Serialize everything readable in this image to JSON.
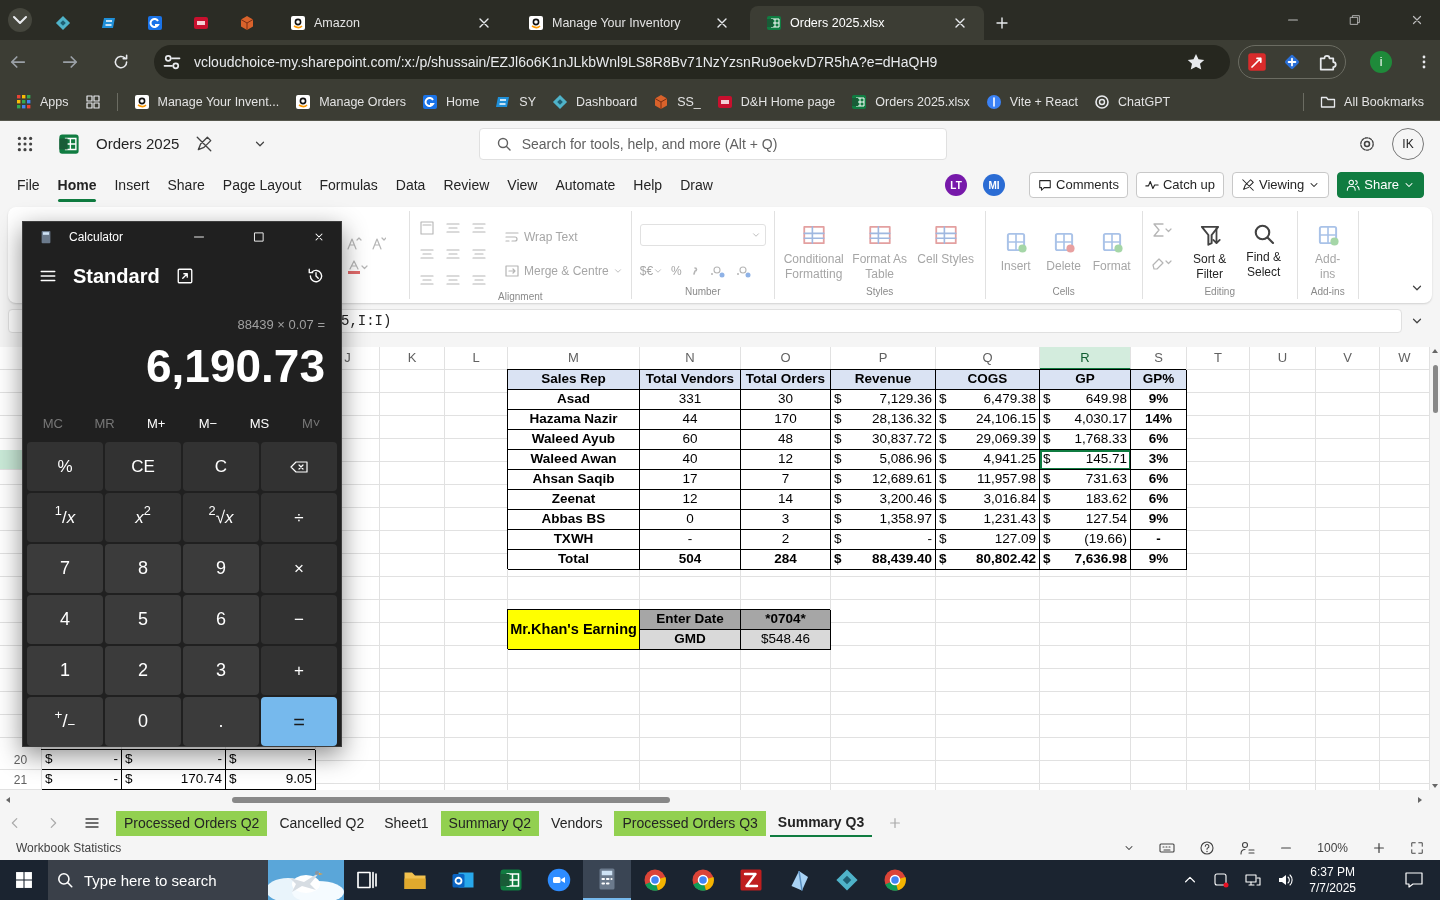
{
  "browser": {
    "tabs": [
      {
        "kind": "pinned",
        "selected": false
      },
      {
        "kind": "pinned",
        "selected": false
      },
      {
        "kind": "pinned",
        "selected": false
      },
      {
        "kind": "pinned",
        "selected": false
      },
      {
        "kind": "pinned",
        "selected": false
      },
      {
        "kind": "page",
        "title": "Amazon",
        "selected": false
      },
      {
        "kind": "page",
        "title": "Manage Your Inventory",
        "selected": false
      },
      {
        "kind": "page",
        "title": "Orders 2025.xlsx",
        "selected": true
      }
    ],
    "url": "vcloudchoice-my.sharepoint.com/:x:/p/shussain/EZJl6o6K1nJLkbWnl9LS8R8Bv71NzYzsnRu9oekvD7R5hA?e=dHaQH9",
    "profile_initial": "i",
    "bookmarks": [
      {
        "label": "Apps"
      },
      {
        "label": "Manage Your Invent..."
      },
      {
        "label": "Manage Orders"
      },
      {
        "label": "Home"
      },
      {
        "label": "SY"
      },
      {
        "label": "Dashboard"
      },
      {
        "label": "SS_"
      },
      {
        "label": "D&H Home page"
      },
      {
        "label": "Orders 2025.xlsx"
      },
      {
        "label": "Vite + React"
      },
      {
        "label": "ChatGPT"
      }
    ],
    "all_bookmarks": "All Bookmarks"
  },
  "excel": {
    "title": "Orders 2025",
    "search_placeholder": "Search for tools, help, and more (Alt + Q)",
    "user_initials": "IK",
    "menu": [
      {
        "label": "File",
        "selected": false
      },
      {
        "label": "Home",
        "selected": true
      },
      {
        "label": "Insert",
        "selected": false
      },
      {
        "label": "Share",
        "selected": false
      },
      {
        "label": "Page Layout",
        "selected": false
      },
      {
        "label": "Formulas",
        "selected": false
      },
      {
        "label": "Data",
        "selected": false
      },
      {
        "label": "Review",
        "selected": false
      },
      {
        "label": "View",
        "selected": false
      },
      {
        "label": "Automate",
        "selected": false
      },
      {
        "label": "Help",
        "selected": false
      },
      {
        "label": "Draw",
        "selected": false
      }
    ],
    "collaborators": [
      {
        "initials": "LT",
        "color": "#7719aa"
      },
      {
        "initials": "MI",
        "color": "#2b6cd4"
      }
    ],
    "actions": [
      {
        "label": "Comments",
        "kind": "comments"
      },
      {
        "label": "Catch up",
        "kind": "catchup"
      },
      {
        "label": "Viewing",
        "kind": "viewing"
      },
      {
        "label": "Share",
        "kind": "share"
      }
    ],
    "ribbon_groups": [
      {
        "label": "Alignment",
        "kind": "alignment",
        "items": [
          "Wrap Text",
          "Merge & Centre"
        ]
      },
      {
        "label": "Number",
        "kind": "number",
        "items": [
          "$€",
          "%"
        ]
      },
      {
        "label": "Styles",
        "kind": "large",
        "items": [
          "Conditional Formatting",
          "Format As Table",
          "Cell Styles"
        ]
      },
      {
        "label": "Cells",
        "kind": "large",
        "items": [
          "Insert",
          "Delete",
          "Format"
        ]
      },
      {
        "label": "Editing",
        "kind": "editing",
        "items": [
          "Sort & Filter",
          "Find & Select"
        ]
      },
      {
        "label": "Add-ins",
        "kind": "large",
        "items": [
          "Add-ins"
        ]
      }
    ],
    "formula": "5,I:I)",
    "columns": [
      {
        "label": "J",
        "selected": false
      },
      {
        "label": "K",
        "selected": false
      },
      {
        "label": "L",
        "selected": false
      },
      {
        "label": "M",
        "selected": false
      },
      {
        "label": "N",
        "selected": false
      },
      {
        "label": "O",
        "selected": false
      },
      {
        "label": "P",
        "selected": false
      },
      {
        "label": "Q",
        "selected": false
      },
      {
        "label": "R",
        "selected": true
      },
      {
        "label": "S",
        "selected": false
      },
      {
        "label": "T",
        "selected": false
      },
      {
        "label": "U",
        "selected": false
      },
      {
        "label": "V",
        "selected": false
      },
      {
        "label": "W",
        "selected": false
      }
    ],
    "summary": {
      "headers": [
        "Sales Rep",
        "Total Vendors",
        "Total Orders",
        "Revenue",
        "COGS",
        "GP",
        "GP%"
      ],
      "rows": [
        {
          "rep": "Asad",
          "vendors": "331",
          "orders": "30",
          "revenue": {
            "cur": "$",
            "amt": "7,129.36"
          },
          "cogs": {
            "cur": "$",
            "amt": "6,479.38"
          },
          "gp": {
            "cur": "$",
            "amt": "649.98"
          },
          "gp_pct": "9%",
          "active": false
        },
        {
          "rep": "Hazama Nazir",
          "vendors": "44",
          "orders": "170",
          "revenue": {
            "cur": "$",
            "amt": "28,136.32"
          },
          "cogs": {
            "cur": "$",
            "amt": "24,106.15"
          },
          "gp": {
            "cur": "$",
            "amt": "4,030.17"
          },
          "gp_pct": "14%",
          "active": false
        },
        {
          "rep": "Waleed Ayub",
          "vendors": "60",
          "orders": "48",
          "revenue": {
            "cur": "$",
            "amt": "30,837.72"
          },
          "cogs": {
            "cur": "$",
            "amt": "29,069.39"
          },
          "gp": {
            "cur": "$",
            "amt": "1,768.33"
          },
          "gp_pct": "6%",
          "active": false
        },
        {
          "rep": "Waleed Awan",
          "vendors": "40",
          "orders": "12",
          "revenue": {
            "cur": "$",
            "amt": "5,086.96"
          },
          "cogs": {
            "cur": "$",
            "amt": "4,941.25"
          },
          "gp": {
            "cur": "$",
            "amt": "145.71"
          },
          "gp_pct": "3%",
          "active": true
        },
        {
          "rep": "Ahsan Saqib",
          "vendors": "17",
          "orders": "7",
          "revenue": {
            "cur": "$",
            "amt": "12,689.61"
          },
          "cogs": {
            "cur": "$",
            "amt": "11,957.98"
          },
          "gp": {
            "cur": "$",
            "amt": "731.63"
          },
          "gp_pct": "6%",
          "active": false
        },
        {
          "rep": "Zeenat",
          "vendors": "12",
          "orders": "14",
          "revenue": {
            "cur": "$",
            "amt": "3,200.46"
          },
          "cogs": {
            "cur": "$",
            "amt": "3,016.84"
          },
          "gp": {
            "cur": "$",
            "amt": "183.62"
          },
          "gp_pct": "6%",
          "active": false
        },
        {
          "rep": "Abbas BS",
          "vendors": "0",
          "orders": "3",
          "revenue": {
            "cur": "$",
            "amt": "1,358.97"
          },
          "cogs": {
            "cur": "$",
            "amt": "1,231.43"
          },
          "gp": {
            "cur": "$",
            "amt": "127.54"
          },
          "gp_pct": "9%",
          "active": false
        },
        {
          "rep": "TXWH",
          "vendors": "-",
          "orders": "2",
          "revenue": {
            "cur": "$",
            "amt": "-"
          },
          "cogs": {
            "cur": "$",
            "amt": "127.09"
          },
          "gp": {
            "cur": "$",
            "amt": "(19.66)"
          },
          "gp_pct": "-",
          "active": false
        }
      ],
      "total": {
        "rep": "Total",
        "vendors": "504",
        "orders": "284",
        "revenue": {
          "cur": "$",
          "amt": "88,439.40"
        },
        "cogs": {
          "cur": "$",
          "amt": "80,802.42"
        },
        "gp": {
          "cur": "$",
          "amt": "7,636.98"
        },
        "gp_pct": "9%"
      }
    },
    "earning": {
      "label": "Mr.Khan's Earning",
      "rows": [
        {
          "label": "Enter Date",
          "value": "*0704*"
        },
        {
          "label": "GMD",
          "value": "$548.46"
        }
      ]
    },
    "lower_rows": [
      {
        "row": "20",
        "cells": [
          {
            "cur": "$",
            "amt": "-"
          },
          {
            "cur": "$",
            "amt": "-"
          },
          {
            "cur": "$",
            "amt": "-"
          }
        ]
      },
      {
        "row": "21",
        "cells": [
          {
            "cur": "$",
            "amt": "-"
          },
          {
            "cur": "$",
            "amt": "170.74"
          },
          {
            "cur": "$",
            "amt": "9.05"
          }
        ]
      }
    ],
    "sheet_tabs": [
      {
        "label": "Processed Orders Q2",
        "selected": false,
        "color": "#92d050"
      },
      {
        "label": "Cancelled Q2",
        "selected": false
      },
      {
        "label": "Sheet1",
        "selected": false
      },
      {
        "label": "Summary Q2",
        "selected": false,
        "color": "#92d050"
      },
      {
        "label": "Vendors",
        "selected": false
      },
      {
        "label": "Processed Orders Q3",
        "selected": false,
        "color": "#92d050"
      },
      {
        "label": "Summary Q3",
        "selected": true
      }
    ],
    "status": "Workbook Statistics",
    "zoom": "100%"
  },
  "calculator": {
    "title": "Calculator",
    "mode": "Standard",
    "expression": "88439 × 0.07 =",
    "display": "6,190.73",
    "memory": [
      {
        "label": "MC",
        "disabled": true
      },
      {
        "label": "MR",
        "disabled": true
      },
      {
        "label": "M+",
        "disabled": false
      },
      {
        "label": "M−",
        "disabled": false
      },
      {
        "label": "MS",
        "disabled": false
      },
      {
        "label": "M˅",
        "disabled": true
      }
    ],
    "keys": [
      {
        "label": "%",
        "kind": "fn"
      },
      {
        "label": "CE",
        "kind": "fn"
      },
      {
        "label": "C",
        "kind": "fn"
      },
      {
        "kind": "backspace"
      },
      {
        "label": "$^{1}$/*x*",
        "kind": "fn"
      },
      {
        "label": "*x*$^{2}$",
        "kind": "fn"
      },
      {
        "label": "$^{2}$√*x*",
        "kind": "fn"
      },
      {
        "label": "÷",
        "kind": "fn"
      },
      {
        "label": "7",
        "kind": "digit"
      },
      {
        "label": "8",
        "kind": "digit"
      },
      {
        "label": "9",
        "kind": "digit"
      },
      {
        "label": "×",
        "kind": "fn"
      },
      {
        "label": "4",
        "kind": "digit"
      },
      {
        "label": "5",
        "kind": "digit"
      },
      {
        "label": "6",
        "kind": "digit"
      },
      {
        "label": "−",
        "kind": "fn"
      },
      {
        "label": "1",
        "kind": "digit"
      },
      {
        "label": "2",
        "kind": "digit"
      },
      {
        "label": "3",
        "kind": "digit"
      },
      {
        "label": "+",
        "kind": "fn"
      },
      {
        "label": "$^{+}$/$_{−}$",
        "kind": "digit"
      },
      {
        "label": "0",
        "kind": "digit"
      },
      {
        "label": ".",
        "kind": "digit"
      },
      {
        "label": "=",
        "kind": "equals"
      }
    ]
  },
  "taskbar": {
    "search_placeholder": "Type here to search",
    "time": "6:37 PM",
    "date": "7/7/2025"
  }
}
